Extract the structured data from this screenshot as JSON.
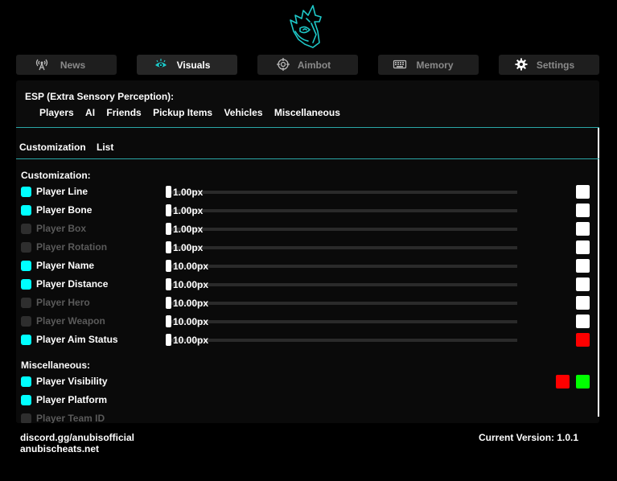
{
  "brand": {
    "logo_icon": "anubis-jackal-logo-icon",
    "accent": "#1ec8c8"
  },
  "tabs": [
    {
      "label": "News",
      "icon": "broadcast-tower-icon",
      "active": false
    },
    {
      "label": "Visuals",
      "icon": "eye-icon",
      "active": true
    },
    {
      "label": "Aimbot",
      "icon": "crosshair-icon",
      "active": false
    },
    {
      "label": "Memory",
      "icon": "keyboard-icon",
      "active": false
    },
    {
      "label": "Settings",
      "icon": "gear-icon",
      "active": false
    }
  ],
  "esp": {
    "title": "ESP (Extra Sensory Perception):",
    "subtabs": [
      "Players",
      "AI",
      "Friends",
      "Pickup Items",
      "Vehicles",
      "Miscellaneous"
    ]
  },
  "inner_tabs": [
    "Customization",
    "List"
  ],
  "customization": {
    "title": "Customization:",
    "rows": [
      {
        "label": "Player Line",
        "enabled": true,
        "value": "1.00px",
        "color": "#ffffff"
      },
      {
        "label": "Player Bone",
        "enabled": true,
        "value": "1.00px",
        "color": "#ffffff"
      },
      {
        "label": "Player Box",
        "enabled": false,
        "value": "1.00px",
        "color": "#ffffff"
      },
      {
        "label": "Player Rotation",
        "enabled": false,
        "value": "1.00px",
        "color": "#ffffff"
      },
      {
        "label": "Player Name",
        "enabled": true,
        "value": "10.00px",
        "color": "#ffffff"
      },
      {
        "label": "Player Distance",
        "enabled": true,
        "value": "10.00px",
        "color": "#ffffff"
      },
      {
        "label": "Player Hero",
        "enabled": false,
        "value": "10.00px",
        "color": "#ffffff"
      },
      {
        "label": "Player Weapon",
        "enabled": false,
        "value": "10.00px",
        "color": "#ffffff"
      },
      {
        "label": "Player Aim Status",
        "enabled": true,
        "value": "10.00px",
        "color": "#ff0000"
      }
    ]
  },
  "miscellaneous": {
    "title": "Miscellaneous:",
    "rows": [
      {
        "label": "Player Visibility",
        "enabled": true,
        "colors": [
          "#ff0000",
          "#00ff00"
        ]
      },
      {
        "label": "Player Platform",
        "enabled": true,
        "colors": []
      },
      {
        "label": "Player Team ID",
        "enabled": false,
        "colors": []
      }
    ]
  },
  "footer": {
    "discord": "discord.gg/anubisofficial",
    "website": "anubischeats.net",
    "version": "Current Version: 1.0.1"
  }
}
